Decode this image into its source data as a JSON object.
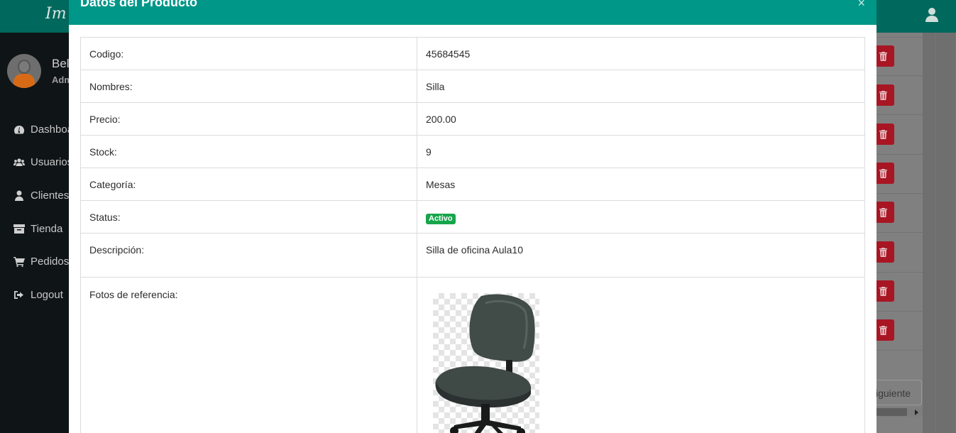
{
  "app": {
    "brand": "Im",
    "user_name": "Bel",
    "user_role": "Adm"
  },
  "sidebar": {
    "items": [
      {
        "label": "Dashboa",
        "icon": "dashboard-icon"
      },
      {
        "label": "Usuarios",
        "icon": "users-icon"
      },
      {
        "label": "Clientes",
        "icon": "user-icon"
      },
      {
        "label": "Tienda",
        "icon": "archive-icon"
      },
      {
        "label": "Pedidos",
        "icon": "cart-icon"
      },
      {
        "label": "Logout",
        "icon": "logout-icon"
      }
    ]
  },
  "background": {
    "next_label": "iguiente"
  },
  "modal": {
    "title": "Datos del Producto",
    "close_label": "×",
    "rows": [
      {
        "label": "Codigo:",
        "value": "45684545"
      },
      {
        "label": "Nombres:",
        "value": "Silla"
      },
      {
        "label": "Precio:",
        "value": "200.00"
      },
      {
        "label": "Stock:",
        "value": "9"
      },
      {
        "label": "Categoría:",
        "value": "Mesas"
      },
      {
        "label": "Status:",
        "value": "Activo"
      },
      {
        "label": "Descripción:",
        "value": "Silla de oficina Aula10"
      },
      {
        "label": "Fotos de referencia:",
        "value": ""
      }
    ],
    "status_color": "#17a54b",
    "header_color": "#009688"
  }
}
